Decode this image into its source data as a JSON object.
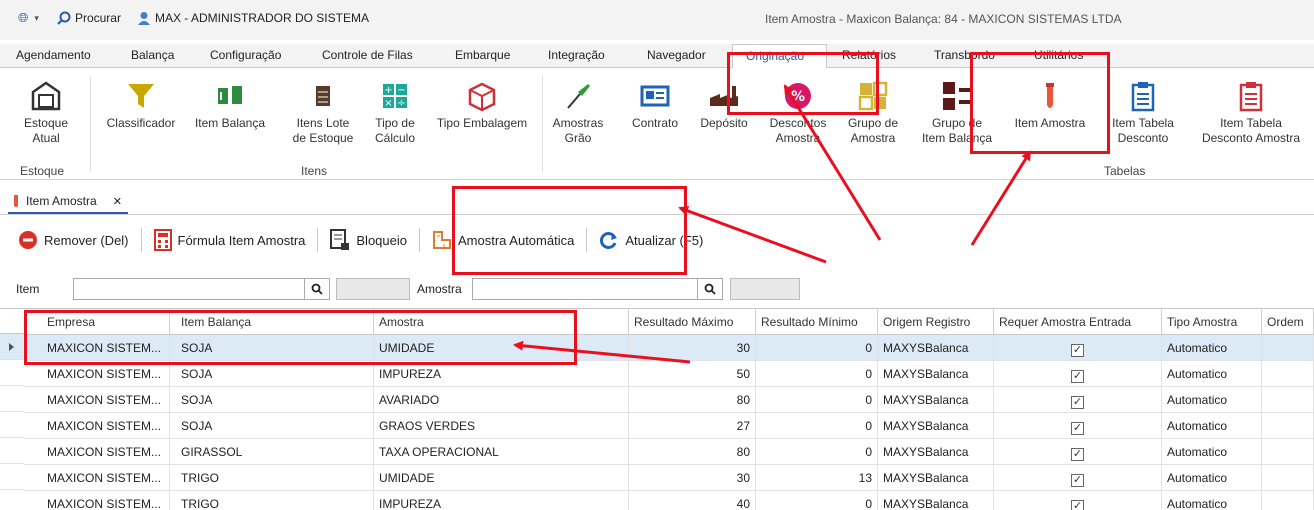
{
  "titlebar": {
    "search_label": "Procurar",
    "user_label": "MAX - ADMINISTRADOR DO SISTEMA",
    "caption": "Item Amostra - Maxicon Balança: 84 - MAXICON SISTEMAS LTDA"
  },
  "menu_tabs": [
    "Agendamento",
    "Balança",
    "Configuração",
    "Controle de Filas",
    "Embarque",
    "Integração",
    "Navegador",
    "Originação",
    "Relatórios",
    "Transbordo",
    "Utilitários"
  ],
  "ribbon": {
    "buttons": [
      {
        "line1": "Estoque",
        "line2": "Atual"
      },
      {
        "line1": "Classificador",
        "line2": ""
      },
      {
        "line1": "Item Balança",
        "line2": ""
      },
      {
        "line1": "Itens Lote",
        "line2": "de Estoque"
      },
      {
        "line1": "Tipo de",
        "line2": "Cálculo"
      },
      {
        "line1": "Tipo Embalagem",
        "line2": ""
      },
      {
        "line1": "Amostras",
        "line2": "Grão"
      },
      {
        "line1": "Contrato",
        "line2": ""
      },
      {
        "line1": "Depósito",
        "line2": ""
      },
      {
        "line1": "Descontos",
        "line2": "Amostra"
      },
      {
        "line1": "Grupo de",
        "line2": "Amostra"
      },
      {
        "line1": "Grupo de",
        "line2": "Item Balança"
      },
      {
        "line1": "Item Amostra",
        "line2": ""
      },
      {
        "line1": "Item Tabela",
        "line2": "Desconto"
      },
      {
        "line1": "Item Tabela",
        "line2": "Desconto Amostra"
      }
    ],
    "groups": [
      "Estoque",
      "Itens",
      "Tabelas"
    ]
  },
  "doc_tab": {
    "label": "Item Amostra",
    "close": "✕"
  },
  "toolbar": {
    "remove": "Remover (Del)",
    "formula": "Fórmula Item Amostra",
    "block": "Bloqueio",
    "auto_sample": "Amostra Automática",
    "refresh": "Atualizar (F5)"
  },
  "filters": {
    "item_label": "Item",
    "sample_label": "Amostra"
  },
  "grid": {
    "columns": [
      "Empresa",
      "Item Balança",
      "Amostra",
      "Resultado Máximo",
      "Resultado Mínimo",
      "Origem Registro",
      "Requer Amostra Entrada",
      "Tipo Amostra",
      "Ordem"
    ],
    "rows": [
      [
        "MAXICON SISTEM...",
        "SOJA",
        "UMIDADE",
        "30",
        "0",
        "MAXYSBalanca",
        "✓",
        "Automatico",
        ""
      ],
      [
        "MAXICON SISTEM...",
        "SOJA",
        "IMPUREZA",
        "50",
        "0",
        "MAXYSBalanca",
        "✓",
        "Automatico",
        ""
      ],
      [
        "MAXICON SISTEM...",
        "SOJA",
        "AVARIADO",
        "80",
        "0",
        "MAXYSBalanca",
        "✓",
        "Automatico",
        ""
      ],
      [
        "MAXICON SISTEM...",
        "SOJA",
        "GRAOS VERDES",
        "27",
        "0",
        "MAXYSBalanca",
        "✓",
        "Automatico",
        ""
      ],
      [
        "MAXICON SISTEM...",
        "GIRASSOL",
        "TAXA OPERACIONAL",
        "80",
        "0",
        "MAXYSBalanca",
        "✓",
        "Automatico",
        ""
      ],
      [
        "MAXICON SISTEM...",
        "TRIGO",
        "UMIDADE",
        "30",
        "13",
        "MAXYSBalanca",
        "✓",
        "Automatico",
        ""
      ],
      [
        "MAXICON SISTEM...",
        "TRIGO",
        "IMPUREZA",
        "40",
        "0",
        "MAXYSBalanca",
        "✓",
        "Automatico",
        ""
      ]
    ]
  },
  "colors": {
    "accent": "#2a5caa",
    "annotation": "#e8101e",
    "selected_row": "#dce9f7"
  }
}
